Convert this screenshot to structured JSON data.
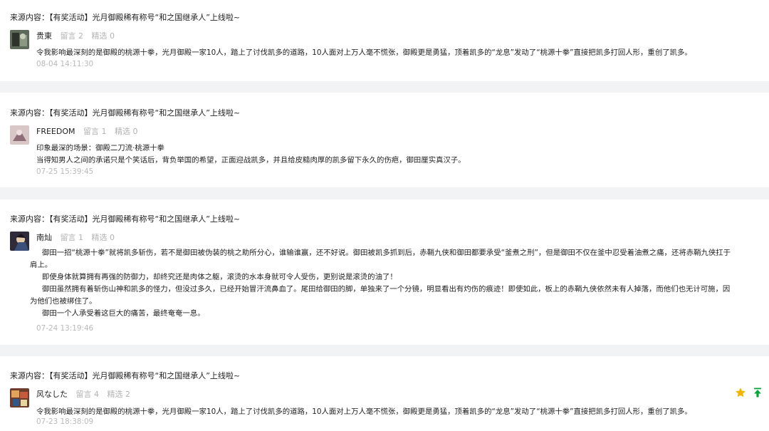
{
  "source_prefix": "来源内容：",
  "source_title": "【有奖活动】光月御殿稀有称号“和之国继承人”上线啦~",
  "reply_label": "留言",
  "pick_label": "精选",
  "comments": [
    {
      "name": "贵東",
      "reply_count": "2",
      "pick_count": "0",
      "lines": [
        "令我影响最深刻的是御殿的桃源十拳，光月御殿一家10人，踏上了讨伐凯多的道路，10人面对上万人毫不慌张，御殿更是勇猛，顶着凯多的“龙息”发动了“桃源十拳”直接把凯多打回人形，重创了凯多。"
      ],
      "time": "08-04 14:11:30"
    },
    {
      "name": "FREEDOM",
      "reply_count": "1",
      "pick_count": "0",
      "lines": [
        "印象最深的场景：御殿二刀流·桃源十拳",
        "当得知男人之间的承诺只是个笑话后，背负举国的希望，正面迎战凯多，并且给皮糙肉厚的凯多留下永久的伤疤，御田厘实真汉子。"
      ],
      "time": "07-25 15:39:45"
    },
    {
      "name": "南灿",
      "reply_count": "1",
      "pick_count": "0",
      "paras": [
        "御田一招“桃源十拳”就将凯多斩伤，若不是御田被伪装的桃之助所分心，谁输谁赢，还不好说。御田被凯多抓到后，赤鞘九侠和御田都要承受“釜煮之刑”，但是御田不仅在釜中忍受着油煮之痛，还将赤鞘九侠扛于肩上。",
        "即使身体就算拥有再强的防御力，却终究还是肉体之躯，滚烫的水本身就可令人受伤，更别说是滚烫的油了！",
        "御田虽然拥有着斩伤山神和凯多的怪力，但没过多久，已经开始冒汗流鼻血了。尾田给御田的脚，单独来了一个分镜，明显看出有灼伤的痕迹！即使如此，板上的赤鞘九侠依然未有人掉落，而他们也无计可施，因为他们也被绑住了。",
        "御田一个人承受着这巨大的痛苦，最终奄奄一息。"
      ],
      "time": "07-24 13:19:46"
    },
    {
      "name": "风なした",
      "reply_count": "4",
      "pick_count": "2",
      "lines": [
        "令我影响最深刻的是御殿的桃源十拳，光月御殿一家10人，踏上了讨伐凯多的道路，10人面对上万人毫不慌张，御殿更是勇猛，顶着凯多的“龙息”发动了“桃源十拳”直接把凯多打回人形，重创了凯多。"
      ],
      "time": "07-23 18:38:09"
    }
  ],
  "icons": {
    "star": "star-icon",
    "pin_top": "pin-top-icon"
  },
  "colors": {
    "star": "#f5b400",
    "pin_top": "#07a43a",
    "muted": "#b2b2b2"
  }
}
